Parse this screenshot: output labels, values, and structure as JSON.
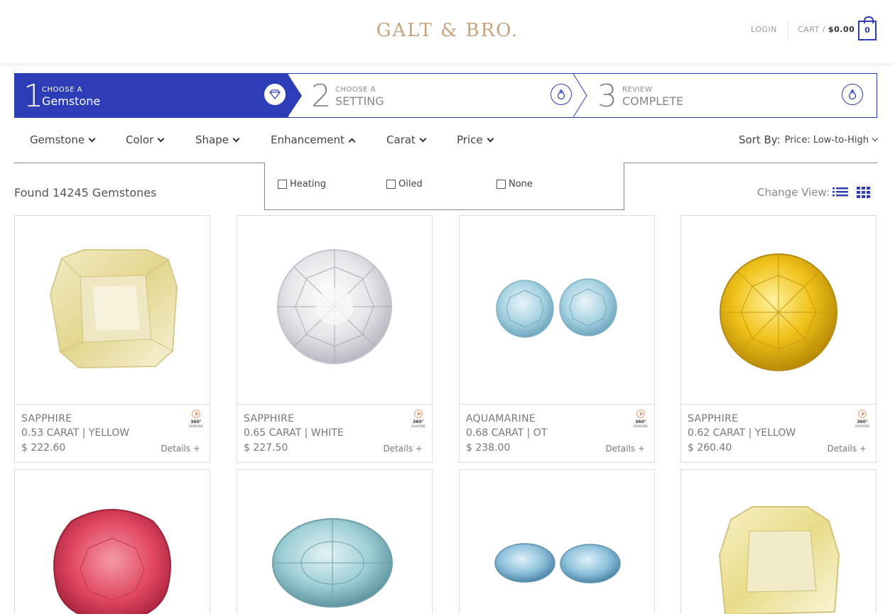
{
  "header": {
    "logo": "GALT & BRO.",
    "login": "LOGIN",
    "cart_label": "CART /",
    "cart_amount": "$0.00",
    "cart_count": "0"
  },
  "steps": [
    {
      "num": "1",
      "sub": "CHOOSE A",
      "title": "Gemstone",
      "icon": "diamond-icon",
      "active": true
    },
    {
      "num": "2",
      "sub": "CHOOSE A",
      "title": "SETTING",
      "icon": "ring-icon",
      "active": false
    },
    {
      "num": "3",
      "sub": "REVIEW",
      "title": "COMPLETE",
      "icon": "ring-icon",
      "active": false
    }
  ],
  "filters": {
    "gemstone": "Gemstone",
    "color": "Color",
    "shape": "Shape",
    "enhancement": "Enhancement",
    "carat": "Carat",
    "price": "Price",
    "sort_label": "Sort By:",
    "sort_value": "Price: Low-to-High"
  },
  "enhancement_options": [
    "Heating",
    "Oiled",
    "None"
  ],
  "results": {
    "found_text": "Found 14245 Gemstones",
    "change_view": "Change View:"
  },
  "badge_360": {
    "line1": "360°",
    "line2": "DIAMOND"
  },
  "products": [
    {
      "name": "SAPPHIRE",
      "desc": "0.53 CARAT | YELLOW",
      "price": "$ 222.60",
      "details": "Details +"
    },
    {
      "name": "SAPPHIRE",
      "desc": "0.65 CARAT | WHITE",
      "price": "$ 227.50",
      "details": "Details +"
    },
    {
      "name": "AQUAMARINE",
      "desc": "0.68 CARAT | OT",
      "price": "$ 238.00",
      "details": "Details +"
    },
    {
      "name": "SAPPHIRE",
      "desc": "0.62 CARAT | YELLOW",
      "price": "$ 260.40",
      "details": "Details +"
    }
  ],
  "colors": {
    "accent": "#2d3db8",
    "logo": "#c8a27c"
  }
}
